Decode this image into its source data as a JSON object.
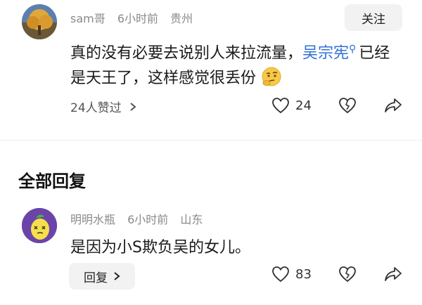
{
  "comment": {
    "username": "sam哥",
    "time": "6小时前",
    "location": "贵州",
    "follow_label": "关注",
    "text_before": "真的没有必要去说别人来拉流量，",
    "mention": "吴宗宪",
    "text_after": "已经是天王了，这样感觉很丢份",
    "likes_summary": "24人赞过",
    "like_count": "24"
  },
  "section": {
    "title": "全部回复"
  },
  "reply": {
    "username": "明明水瓶",
    "time": "6小时前",
    "location": "山东",
    "text": "是因为小S欺负吴的女儿。",
    "reply_label": "回复",
    "like_count": "83"
  },
  "colors": {
    "mention": "#2e6fd8",
    "meta": "#8a8a8a",
    "button_bg": "#f2f2f2"
  }
}
